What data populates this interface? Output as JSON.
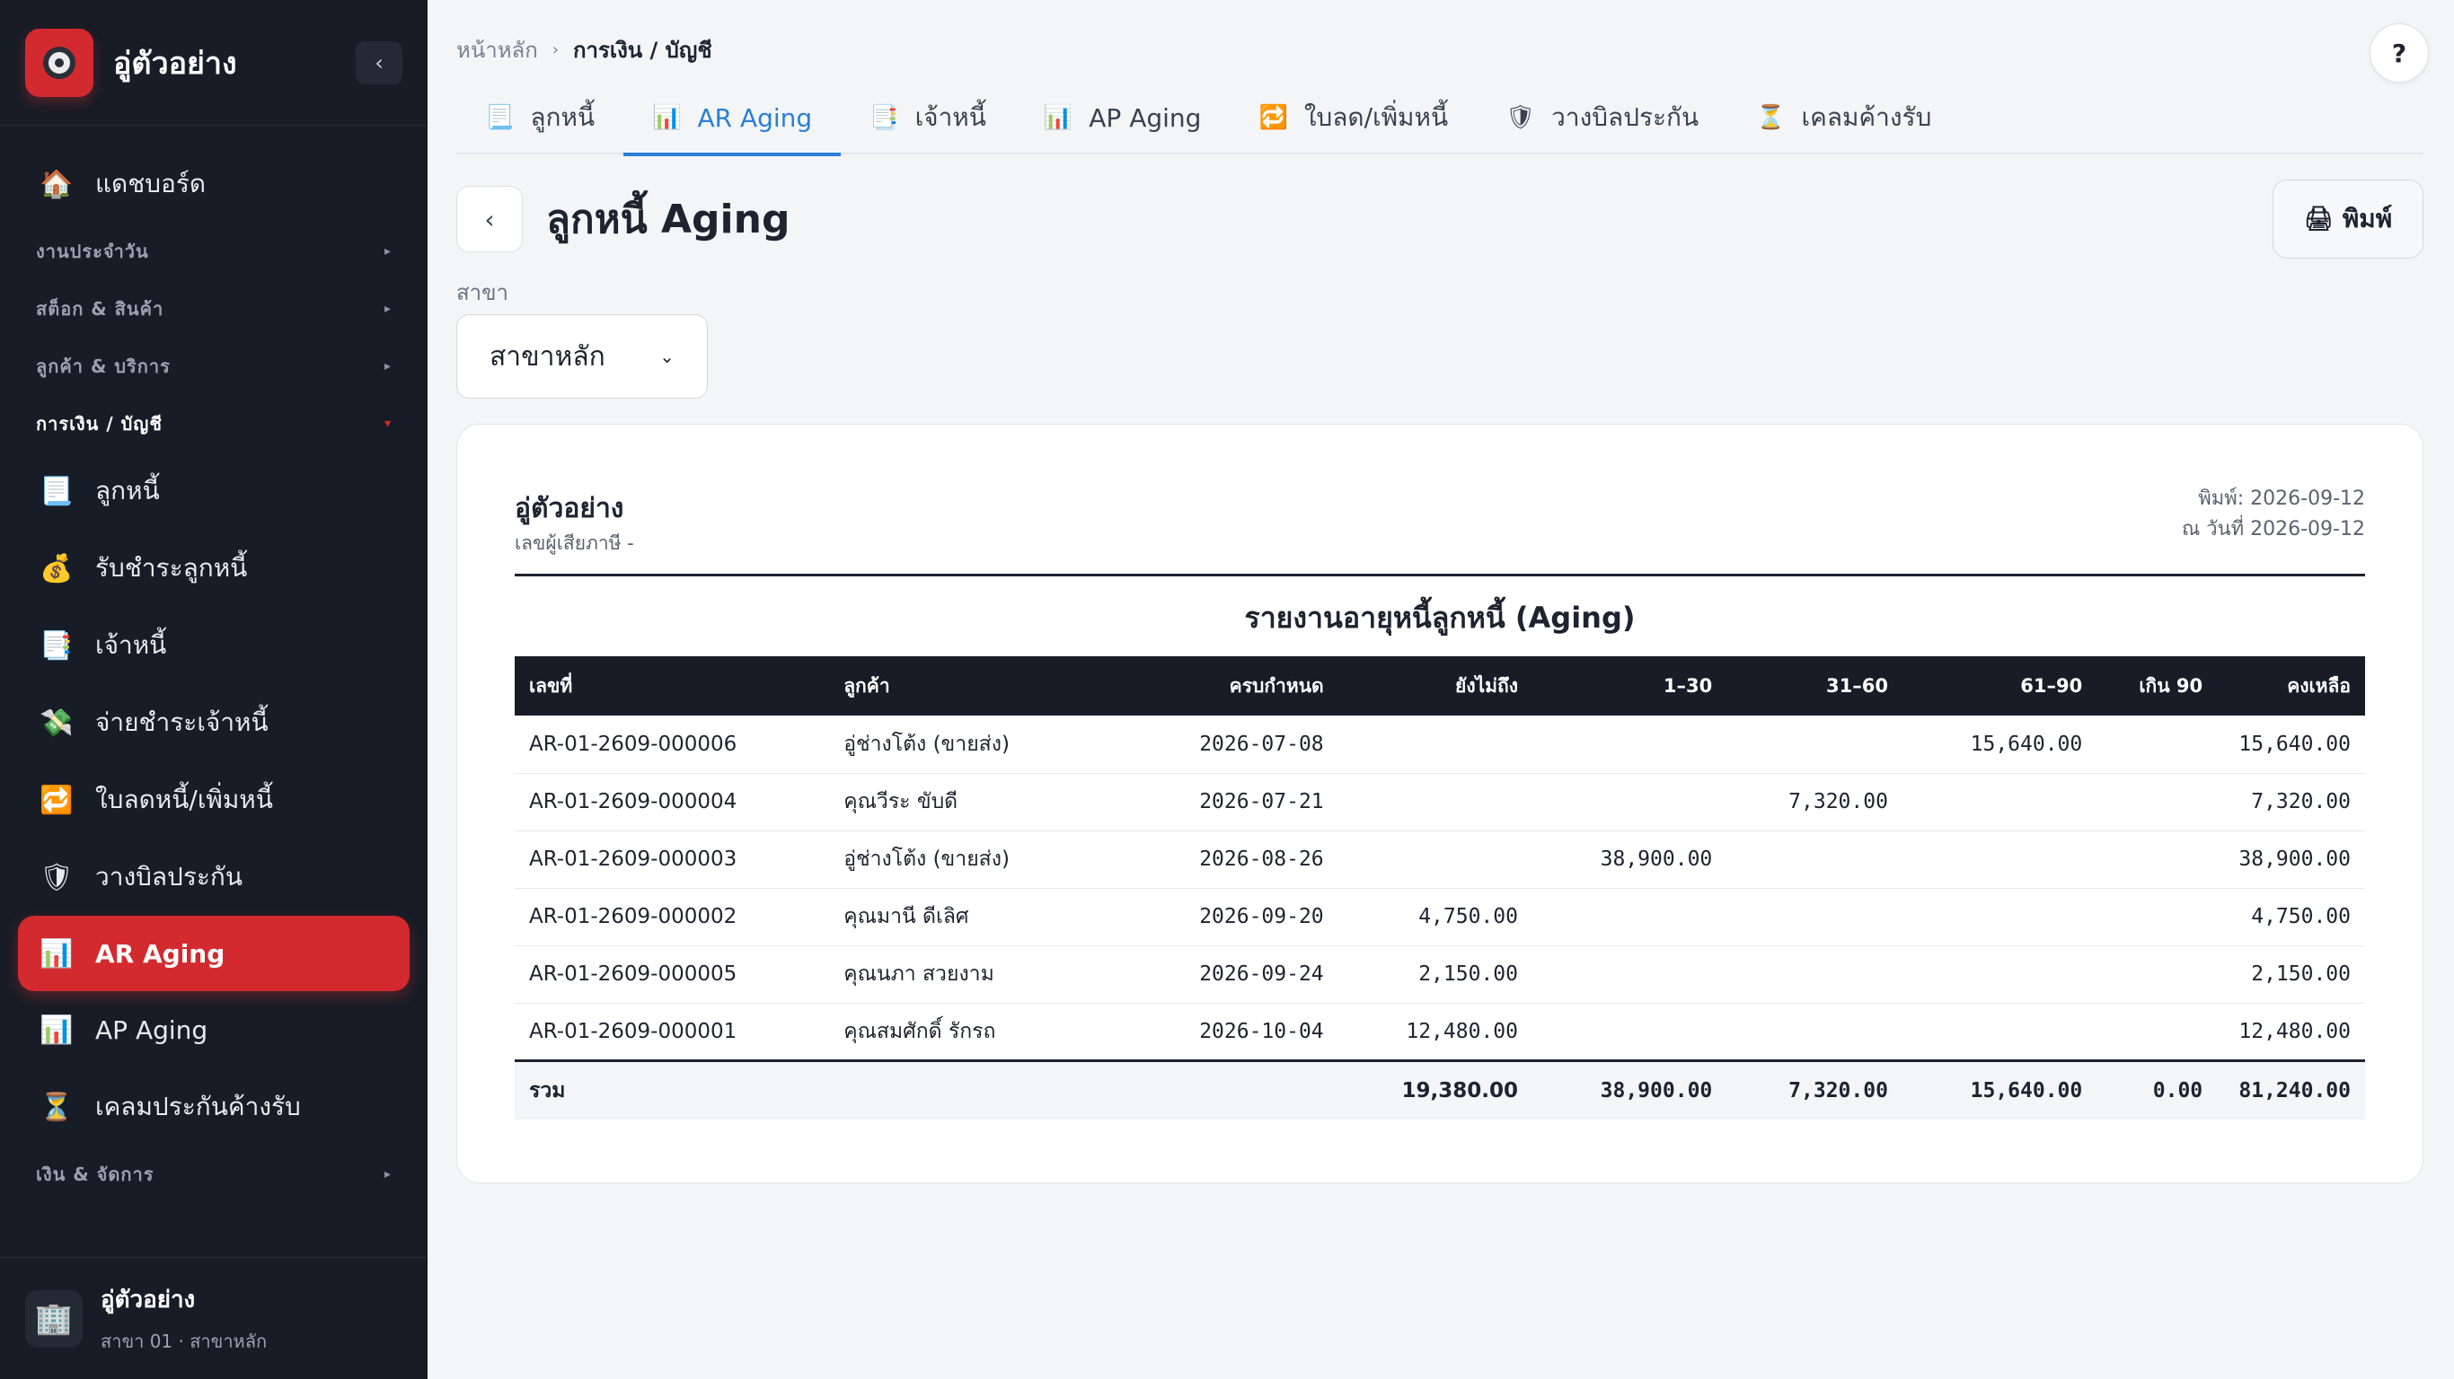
{
  "sidebar": {
    "brand_name": "อู่ตัวอย่าง",
    "collapse_label": "‹",
    "items": [
      {
        "type": "item",
        "label": "แดชบอร์ด",
        "icon": "🏠",
        "icon_name": "home-icon"
      },
      {
        "type": "section",
        "label": "งานประจำวัน",
        "caret": "▸"
      },
      {
        "type": "section",
        "label": "สต็อก & สินค้า",
        "caret": "▸"
      },
      {
        "type": "section",
        "label": "ลูกค้า & บริการ",
        "caret": "▸"
      },
      {
        "type": "section",
        "label": "การเงิน / บัญชี",
        "caret": "▾",
        "open": true
      },
      {
        "type": "item",
        "label": "ลูกหนี้",
        "icon": "📃",
        "icon_name": "receivable-icon"
      },
      {
        "type": "item",
        "label": "รับชำระลูกหนี้",
        "icon": "💰",
        "icon_name": "money-bag-icon"
      },
      {
        "type": "item",
        "label": "เจ้าหนี้",
        "icon": "📑",
        "icon_name": "payable-icon"
      },
      {
        "type": "item",
        "label": "จ่ายชำระเจ้าหนี้",
        "icon": "💸",
        "icon_name": "money-wings-icon"
      },
      {
        "type": "item",
        "label": "ใบลดหนี้/เพิ่มหนี้",
        "icon": "🔁",
        "icon_name": "credit-note-icon"
      },
      {
        "type": "item",
        "label": "วางบิลประกัน",
        "icon": "🛡",
        "icon_name": "shield-icon"
      },
      {
        "type": "item",
        "label": "AR Aging",
        "icon": "📊",
        "icon_name": "bar-chart-icon",
        "active": true
      },
      {
        "type": "item",
        "label": "AP Aging",
        "icon": "📊",
        "icon_name": "bar-chart-icon"
      },
      {
        "type": "item",
        "label": "เคลมประกันค้างรับ",
        "icon": "⏳",
        "icon_name": "hourglass-icon"
      },
      {
        "type": "section",
        "label": "เงิน & จัดการ",
        "caret": "▸"
      }
    ],
    "footer": {
      "name": "อู่ตัวอย่าง",
      "sub": "สาขา 01 · สาขาหลัก",
      "icon": "🏢"
    }
  },
  "breadcrumb": {
    "home": "หน้าหลัก",
    "sep": "›",
    "current": "การเงิน / บัญชี"
  },
  "help_label": "?",
  "tabs": [
    {
      "label": "ลูกหนี้",
      "icon": "📃",
      "icon_name": "receivable-icon"
    },
    {
      "label": "AR Aging",
      "icon": "📊",
      "icon_name": "bar-chart-icon",
      "active": true
    },
    {
      "label": "เจ้าหนี้",
      "icon": "📑",
      "icon_name": "payable-icon"
    },
    {
      "label": "AP Aging",
      "icon": "📊",
      "icon_name": "bar-chart-icon"
    },
    {
      "label": "ใบลด/เพิ่มหนี้",
      "icon": "🔁",
      "icon_name": "credit-note-icon"
    },
    {
      "label": "วางบิลประกัน",
      "icon": "🛡",
      "icon_name": "shield-icon"
    },
    {
      "label": "เคลมค้างรับ",
      "icon": "⏳",
      "icon_name": "hourglass-icon"
    }
  ],
  "page": {
    "back_label": "‹",
    "title": "ลูกหนี้ Aging",
    "print_label": "พิมพ์",
    "print_icon": "🖨",
    "filter_label": "สาขา",
    "branch_value": "สาขาหลัก"
  },
  "report": {
    "company": "อู่ตัวอย่าง",
    "tax_id": "เลขผู้เสียภาษี -",
    "printed": "พิมพ์: 2026-09-12",
    "as_of": "ณ วันที่ 2026-09-12",
    "title": "รายงานอายุหนี้ลูกหนี้ (Aging)",
    "columns": [
      "เลขที่",
      "ลูกค้า",
      "ครบกำหนด",
      "ยังไม่ถึง",
      "1–30",
      "31–60",
      "61–90",
      "เกิน 90",
      "คงเหลือ"
    ],
    "rows": [
      {
        "no": "AR-01-2609-000006",
        "customer": "อู่ช่างโต้ง (ขายส่ง)",
        "due": "2026-07-08",
        "not_due": "",
        "d1_30": "",
        "d31_60": "",
        "d61_90": "15,640.00",
        "over90": "",
        "balance": "15,640.00"
      },
      {
        "no": "AR-01-2609-000004",
        "customer": "คุณวีระ ขับดี",
        "due": "2026-07-21",
        "not_due": "",
        "d1_30": "",
        "d31_60": "7,320.00",
        "d61_90": "",
        "over90": "",
        "balance": "7,320.00"
      },
      {
        "no": "AR-01-2609-000003",
        "customer": "อู่ช่างโต้ง (ขายส่ง)",
        "due": "2026-08-26",
        "not_due": "",
        "d1_30": "38,900.00",
        "d31_60": "",
        "d61_90": "",
        "over90": "",
        "balance": "38,900.00"
      },
      {
        "no": "AR-01-2609-000002",
        "customer": "คุณมานี ดีเลิศ",
        "due": "2026-09-20",
        "not_due": "4,750.00",
        "d1_30": "",
        "d31_60": "",
        "d61_90": "",
        "over90": "",
        "balance": "4,750.00"
      },
      {
        "no": "AR-01-2609-000005",
        "customer": "คุณนภา สวยงาม",
        "due": "2026-09-24",
        "not_due": "2,150.00",
        "d1_30": "",
        "d31_60": "",
        "d61_90": "",
        "over90": "",
        "balance": "2,150.00"
      },
      {
        "no": "AR-01-2609-000001",
        "customer": "คุณสมศักดิ์ รักรถ",
        "due": "2026-10-04",
        "not_due": "12,480.00",
        "d1_30": "",
        "d31_60": "",
        "d61_90": "",
        "over90": "",
        "balance": "12,480.00"
      }
    ],
    "total": {
      "label": "รวม",
      "not_due": "19,380.00",
      "d1_30": "38,900.00",
      "d31_60": "7,320.00",
      "d61_90": "15,640.00",
      "over90": "0.00",
      "balance": "81,240.00"
    }
  }
}
